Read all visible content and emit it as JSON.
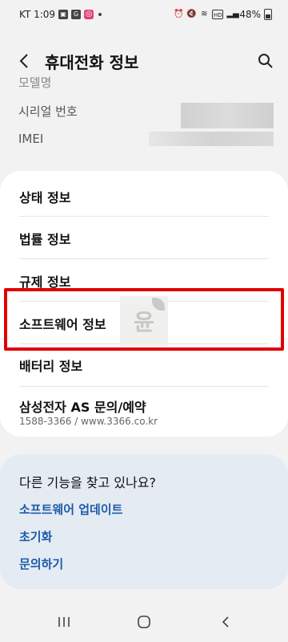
{
  "status_bar": {
    "time_carrier": "KT 1:09",
    "battery": "48%"
  },
  "header": {
    "title": "휴대전화 정보"
  },
  "info": {
    "cut_label": "모델명",
    "serial_label": "시리얼 번호",
    "imei_label": "IMEI"
  },
  "menu": {
    "items": [
      {
        "label": "상태 정보"
      },
      {
        "label": "법률 정보"
      },
      {
        "label": "규제 정보"
      },
      {
        "label": "소프트웨어 정보"
      },
      {
        "label": "배터리 정보"
      },
      {
        "label": "삼성전자 AS 문의/예약",
        "sub": "1588-3366 / www.3366.co.kr"
      }
    ]
  },
  "watermark": {
    "text": "윤"
  },
  "suggestions": {
    "title": "다른 기능을 찾고 있나요?",
    "links": [
      "소프트웨어 업데이트",
      "초기화",
      "문의하기"
    ]
  },
  "colors": {
    "highlight": "#e00000",
    "link": "#1c5aa8",
    "suggest_bg": "#e4ebf3"
  }
}
